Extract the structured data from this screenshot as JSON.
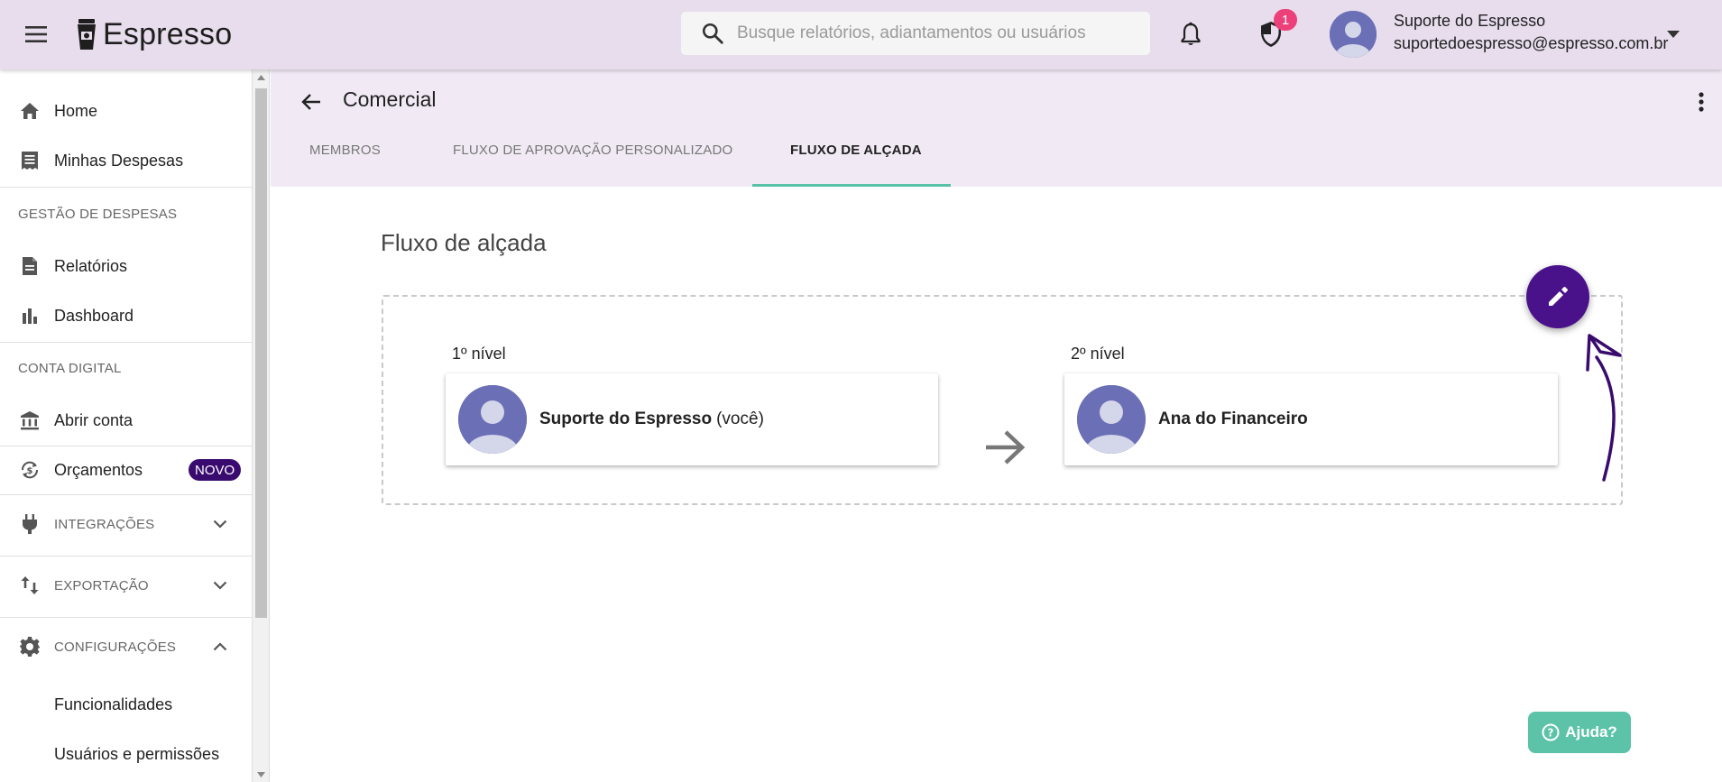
{
  "app": {
    "name": "Espresso",
    "accent_color": "#4a128a",
    "teal_color": "#5cc3a8"
  },
  "topbar": {
    "search_placeholder": "Busque relatórios, adiantamentos ou usuários",
    "notification_count": "1",
    "user_name": "Suporte do Espresso",
    "user_email": "suportedoespresso@espresso.com.br"
  },
  "sidebar": {
    "items": [
      {
        "label": "Home",
        "icon": "home-icon"
      },
      {
        "label": "Minhas Despesas",
        "icon": "receipt-icon"
      }
    ],
    "section_expenses": "GESTÃO DE DESPESAS",
    "expense_items": [
      {
        "label": "Relatórios",
        "icon": "document-icon"
      },
      {
        "label": "Dashboard",
        "icon": "bar-chart-icon"
      }
    ],
    "section_account": "CONTA DIGITAL",
    "account_items": [
      {
        "label": "Abrir conta",
        "icon": "bank-icon"
      },
      {
        "label": "Orçamentos",
        "icon": "budget-icon",
        "badge": "NOVO"
      }
    ],
    "groups": [
      {
        "label": "INTEGRAÇÕES",
        "icon": "plug-icon",
        "expanded": false
      },
      {
        "label": "EXPORTAÇÃO",
        "icon": "swap-vertical-icon",
        "expanded": false
      },
      {
        "label": "CONFIGURAÇÕES",
        "icon": "gear-icon",
        "expanded": true
      }
    ],
    "settings_children": [
      {
        "label": "Funcionalidades"
      },
      {
        "label": "Usuários e permissões"
      }
    ]
  },
  "header": {
    "title": "Comercial",
    "tabs": [
      {
        "label": "MEMBROS",
        "active": false
      },
      {
        "label": "FLUXO DE APROVAÇÃO PERSONALIZADO",
        "active": false
      },
      {
        "label": "FLUXO DE ALÇADA",
        "active": true
      }
    ]
  },
  "content": {
    "heading": "Fluxo de alçada",
    "levels": [
      {
        "label": "1º nível",
        "name": "Suporte do Espresso",
        "suffix": "(você)"
      },
      {
        "label": "2º nível",
        "name": "Ana do Financeiro",
        "suffix": ""
      }
    ],
    "help_label": "Ajuda?"
  }
}
